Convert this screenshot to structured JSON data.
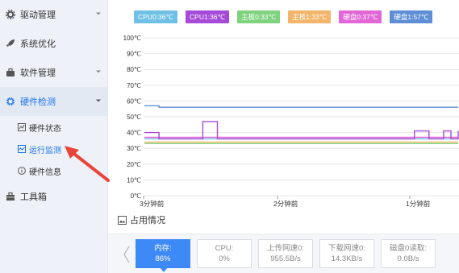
{
  "sidebar": {
    "items": [
      {
        "label": "驱动管理"
      },
      {
        "label": "系统优化"
      },
      {
        "label": "软件管理"
      },
      {
        "label": "硬件检测"
      },
      {
        "label": "工具箱"
      }
    ],
    "sub_items": [
      {
        "label": "硬件状态"
      },
      {
        "label": "运行监测"
      },
      {
        "label": "硬件信息"
      }
    ]
  },
  "legend": [
    {
      "label": "CPU0:36℃",
      "color": "#6ec1e4"
    },
    {
      "label": "CPU1:36℃",
      "color": "#a64bd9"
    },
    {
      "label": "主板0:33℃",
      "color": "#7fd37f"
    },
    {
      "label": "主板1:33℃",
      "color": "#f2b56b"
    },
    {
      "label": "硬盘0:37℃",
      "color": "#e267d6"
    },
    {
      "label": "硬盘1:57℃",
      "color": "#5e8fd6"
    }
  ],
  "chart_data": {
    "type": "line",
    "y_ticks": [
      "100℃",
      "90℃",
      "80℃",
      "70℃",
      "60℃",
      "50℃",
      "40℃",
      "30℃",
      "20℃",
      "10℃",
      "0℃"
    ],
    "x_ticks": [
      "3分钟前",
      "2分钟前",
      "1分钟前"
    ],
    "ylim": [
      0,
      100
    ],
    "grid": true,
    "series": [
      {
        "name": "CPU0:36℃",
        "values": [
          36,
          36,
          36,
          36,
          36,
          36,
          36,
          36,
          36,
          36,
          36,
          36,
          36,
          36,
          36,
          36,
          36,
          36,
          36,
          36,
          36,
          36,
          36,
          36,
          36,
          36,
          36,
          36,
          36,
          36,
          36,
          36,
          36,
          36,
          36,
          36,
          36,
          36,
          36,
          36,
          36,
          36,
          36,
          36
        ]
      },
      {
        "name": "CPU1:36℃",
        "values": [
          40,
          40,
          36,
          36,
          36,
          36,
          36,
          36,
          47,
          47,
          36,
          36,
          36,
          36,
          36,
          36,
          36,
          36,
          36,
          36,
          36,
          36,
          36,
          36,
          36,
          36,
          36,
          36,
          36,
          36,
          36,
          36,
          36,
          36,
          36,
          36,
          36,
          41,
          41,
          36,
          36,
          41,
          36,
          41
        ]
      },
      {
        "name": "主板0:33℃",
        "values": [
          33,
          33,
          33,
          33,
          33,
          33,
          33,
          33,
          33,
          33,
          33,
          33,
          33,
          33,
          33,
          33,
          33,
          33,
          33,
          33,
          33,
          33,
          33,
          33,
          33,
          33,
          33,
          33,
          33,
          33,
          33,
          33,
          33,
          33,
          33,
          33,
          33,
          33,
          33,
          33,
          33,
          33,
          33,
          33
        ]
      },
      {
        "name": "主板1:33℃",
        "values": [
          34,
          34,
          34,
          34,
          34,
          34,
          34,
          34,
          34,
          34,
          34,
          34,
          34,
          34,
          34,
          34,
          34,
          34,
          34,
          34,
          34,
          34,
          34,
          34,
          34,
          34,
          34,
          34,
          34,
          34,
          34,
          34,
          34,
          34,
          34,
          34,
          34,
          34,
          34,
          34,
          34,
          34,
          34,
          34
        ]
      },
      {
        "name": "硬盘0:37℃",
        "values": [
          37,
          37,
          37,
          37,
          37,
          37,
          37,
          37,
          37,
          37,
          37,
          37,
          37,
          37,
          37,
          37,
          37,
          37,
          37,
          37,
          37,
          37,
          37,
          37,
          37,
          37,
          37,
          37,
          37,
          37,
          37,
          37,
          37,
          37,
          37,
          37,
          37,
          37,
          37,
          37,
          37,
          37,
          37,
          37
        ]
      },
      {
        "name": "硬盘1:57℃",
        "values": [
          57,
          57,
          56,
          56,
          56,
          56,
          56,
          56,
          56,
          56,
          56,
          56,
          56,
          56,
          56,
          56,
          56,
          56,
          56,
          56,
          56,
          56,
          56,
          56,
          56,
          56,
          56,
          56,
          56,
          56,
          56,
          56,
          56,
          56,
          56,
          56,
          56,
          56,
          56,
          56,
          56,
          56,
          56,
          56
        ]
      }
    ]
  },
  "usage_title": "占用情况",
  "cards": [
    {
      "line1": "内存:",
      "line2": "86%"
    },
    {
      "line1": "CPU:",
      "line2": "0%"
    },
    {
      "line1": "上传网速0:",
      "line2": "955.5B/s"
    },
    {
      "line1": "下载网速0:",
      "line2": "14.3KB/s"
    },
    {
      "line1": "磁盘0读取:",
      "line2": "0.0B/s"
    }
  ],
  "accent": "#3d8af7",
  "annotation_color": "#e8443a"
}
